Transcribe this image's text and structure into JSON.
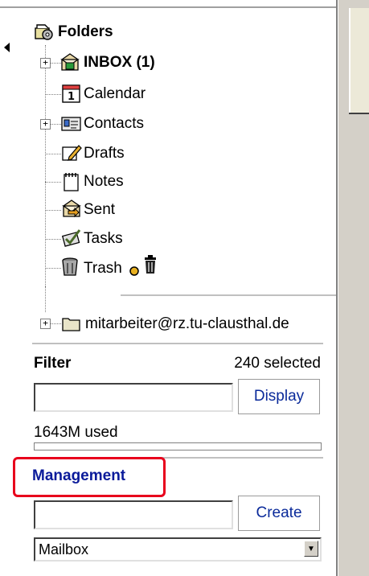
{
  "tree": {
    "root_label": "Folders",
    "items": [
      {
        "label": "INBOX (1)",
        "icon": "inbox-icon",
        "bold": true,
        "expandable": true
      },
      {
        "label": "Calendar",
        "icon": "calendar-icon",
        "bold": false,
        "expandable": false,
        "icon_text": "1"
      },
      {
        "label": "Contacts",
        "icon": "contacts-icon",
        "bold": false,
        "expandable": true
      },
      {
        "label": "Drafts",
        "icon": "drafts-icon",
        "bold": false,
        "expandable": false
      },
      {
        "label": "Notes",
        "icon": "notes-icon",
        "bold": false,
        "expandable": false
      },
      {
        "label": "Sent",
        "icon": "sent-icon",
        "bold": false,
        "expandable": false
      },
      {
        "label": "Tasks",
        "icon": "tasks-icon",
        "bold": false,
        "expandable": false
      },
      {
        "label": "Trash",
        "icon": "trash-icon",
        "bold": false,
        "expandable": false
      }
    ],
    "account_label": "mitarbeiter@rz.tu-clausthal.de",
    "expander_symbol": "+"
  },
  "filter": {
    "title": "Filter",
    "count_text": "240 selected",
    "input_value": "",
    "button_label": "Display"
  },
  "quota": {
    "used_text": "1643M used",
    "fraction_used": 0.0
  },
  "management": {
    "title": "Management",
    "input_value": "",
    "button_label": "Create",
    "select_value": "Mailbox",
    "highlight_color": "#e8001c",
    "title_color": "#0a1a9a"
  }
}
